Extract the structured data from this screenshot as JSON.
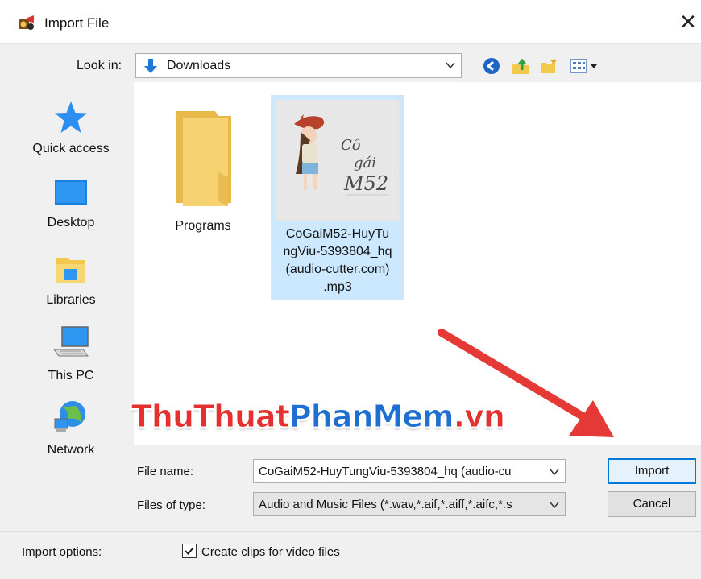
{
  "window": {
    "title": "Import File",
    "close_glyph": "✕"
  },
  "lookin": {
    "label": "Look in:",
    "value": "Downloads"
  },
  "toolbar": {
    "icons": [
      "back-icon",
      "up-folder-icon",
      "new-folder-icon",
      "view-menu-icon"
    ]
  },
  "places": [
    {
      "label": "Quick access",
      "icon": "star-icon"
    },
    {
      "label": "Desktop",
      "icon": "desktop-icon"
    },
    {
      "label": "Libraries",
      "icon": "libraries-icon"
    },
    {
      "label": "This PC",
      "icon": "computer-icon"
    },
    {
      "label": "Network",
      "icon": "network-icon"
    }
  ],
  "files": [
    {
      "name": "Programs",
      "kind": "folder",
      "selected": false
    },
    {
      "name_lines": [
        "CoGaiM52-HuyTu",
        "ngViu-5393804_hq",
        "(audio-cutter.com)",
        ".mp3"
      ],
      "kind": "audio-thumbnail",
      "selected": true,
      "thumb_text": [
        "Cô",
        "gái",
        "M52"
      ]
    }
  ],
  "form": {
    "filename_label": "File name:",
    "filename_value": "CoGaiM52-HuyTungViu-5393804_hq (audio-cu",
    "filetype_label": "Files of type:",
    "filetype_value": "Audio and Music Files (*.wav,*.aif,*.aiff,*.aifc,*.s"
  },
  "buttons": {
    "import": "Import",
    "cancel": "Cancel"
  },
  "options": {
    "label": "Import options:",
    "checkbox_label": "Create clips for video files",
    "checked": true
  },
  "watermark": {
    "part1": "ThuThuat",
    "part2": "PhanMem",
    "part3": ".vn"
  },
  "colors": {
    "accent": "#0078d7",
    "selection": "#cce8ff",
    "arrow": "#e53935",
    "wm_red": "#e53030",
    "wm_blue": "#1f6fd1"
  }
}
